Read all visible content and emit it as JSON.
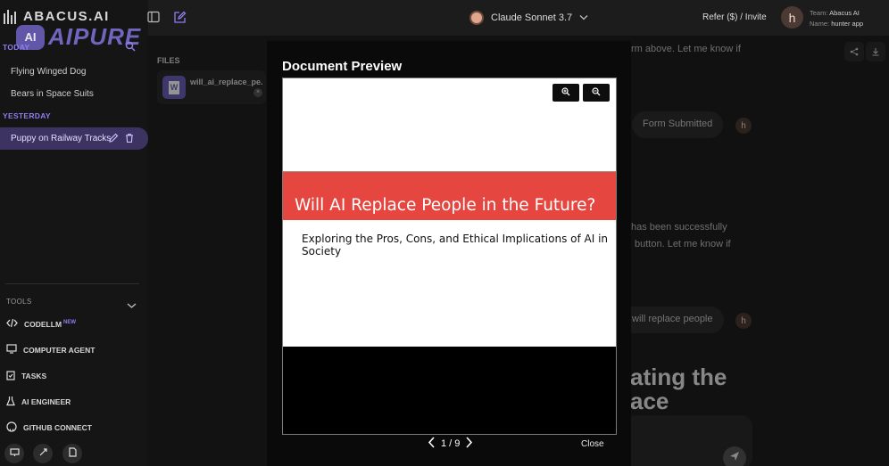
{
  "app": {
    "logo": "ABACUS.AI",
    "watermark": "AIPURE",
    "watermark_badge": "AI"
  },
  "sidebar": {
    "today_label": "TODAY",
    "today_items": [
      "Flying Winged Dog",
      "Bears in Space Suits"
    ],
    "yesterday_label": "YESTERDAY",
    "active_item": "Puppy on Railway Tracks",
    "tools_label": "TOOLS",
    "tools": [
      {
        "label": "CODELLM",
        "badge": "NEW",
        "icon": "code-icon"
      },
      {
        "label": "COMPUTER AGENT",
        "icon": "monitor-icon"
      },
      {
        "label": "TASKS",
        "icon": "clipboard-icon"
      },
      {
        "label": "AI ENGINEER",
        "icon": "flask-icon"
      },
      {
        "label": "GITHUB CONNECT",
        "icon": "github-icon"
      }
    ]
  },
  "header": {
    "model": "Claude Sonnet 3.7",
    "refer": "Refer ($) / Invite",
    "avatar_initial": "h",
    "team_key": "Team:",
    "team_value": "Abacus AI",
    "name_key": "Name:",
    "name_value": "hunter app"
  },
  "files": {
    "label": "FILES",
    "file_name": "will_ai_replace_pe...",
    "file_type": "W"
  },
  "chat_background": {
    "line1": "rm above. Let me know if",
    "bubble1": "Form Submitted",
    "line2": "has been successfully",
    "line3": "button. Let me know if",
    "bubble2": "will replace people",
    "big1": "ating the",
    "big2": "ace",
    "avatar_initial": "h"
  },
  "modal": {
    "title": "Document Preview",
    "slide_title": "Will AI Replace People in the Future?",
    "slide_subtitle": "Exploring the Pros, Cons, and Ethical Implications of AI in Society",
    "page_indicator": "1 / 9",
    "close_label": "Close"
  },
  "colors": {
    "accent": "#8d7ef0",
    "slide_band": "#e5463f",
    "active_bg": "#3c3363"
  }
}
